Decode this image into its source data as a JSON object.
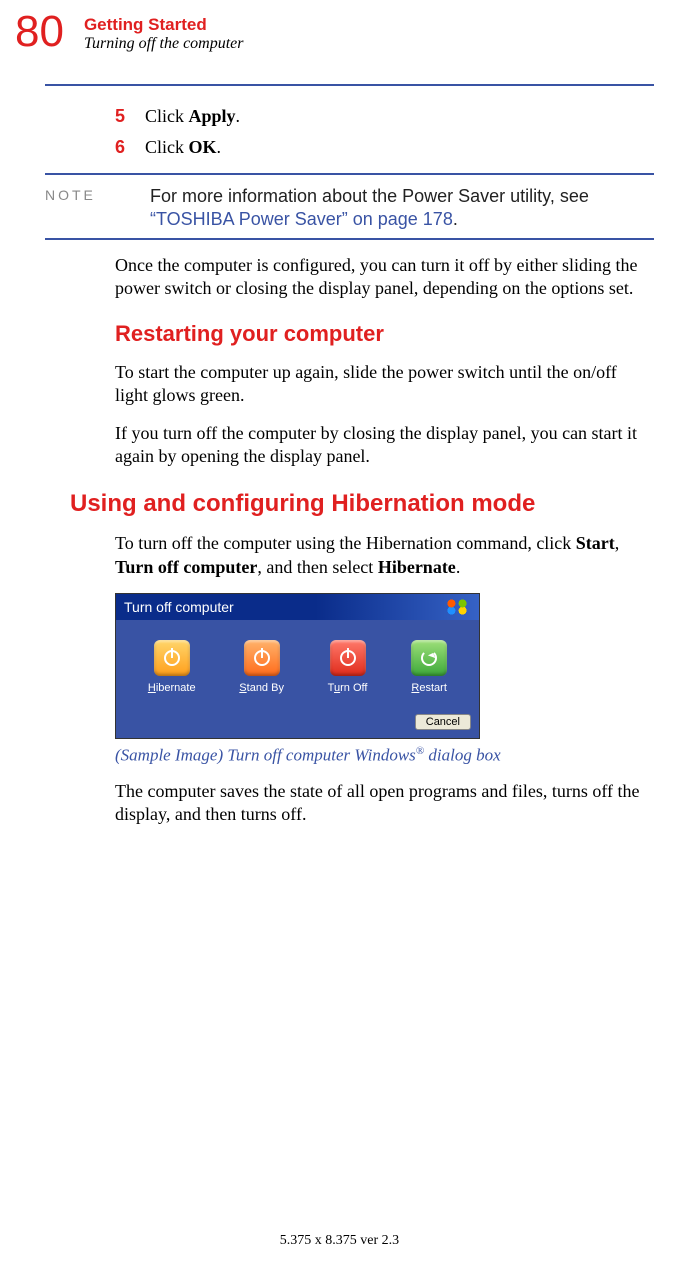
{
  "header": {
    "page_number": "80",
    "chapter": "Getting Started",
    "section": "Turning off the computer"
  },
  "steps": [
    {
      "num": "5",
      "prefix": "Click ",
      "bold": "Apply",
      "suffix": "."
    },
    {
      "num": "6",
      "prefix": "Click ",
      "bold": "OK",
      "suffix": "."
    }
  ],
  "note": {
    "label": "NOTE",
    "text": "For more information about the Power Saver utility, see ",
    "link": "“TOSHIBA Power Saver” on page 178",
    "after_link": "."
  },
  "para1": "Once the computer is configured, you can turn it off by either sliding the power switch or closing the display panel, depending on the options set.",
  "h3_restart": "Restarting your computer",
  "para2": "To start the computer up again, slide the power switch until the on/off light glows green.",
  "para3": "If you turn off the computer by closing the display panel, you can start it again by opening the display panel.",
  "h2_hibernate": "Using and configuring Hibernation mode",
  "para4": {
    "t1": "To turn off the computer using the Hibernation command, click ",
    "b1": "Start",
    "t2": ", ",
    "b2": "Turn off computer",
    "t3": ", and then select ",
    "b3": "Hibernate",
    "t4": "."
  },
  "dialog": {
    "title": "Turn off computer",
    "options": {
      "hibernate": "Hibernate",
      "standby": "Stand By",
      "turnoff": "Turn Off",
      "restart": "Restart"
    },
    "cancel": "Cancel"
  },
  "caption": {
    "text": "(Sample Image) Turn off computer Windows",
    "reg": "®",
    "after": " dialog box"
  },
  "para5": "The computer saves the state of all open programs and files, turns off the display, and then turns off.",
  "footer": "5.375 x 8.375 ver 2.3"
}
